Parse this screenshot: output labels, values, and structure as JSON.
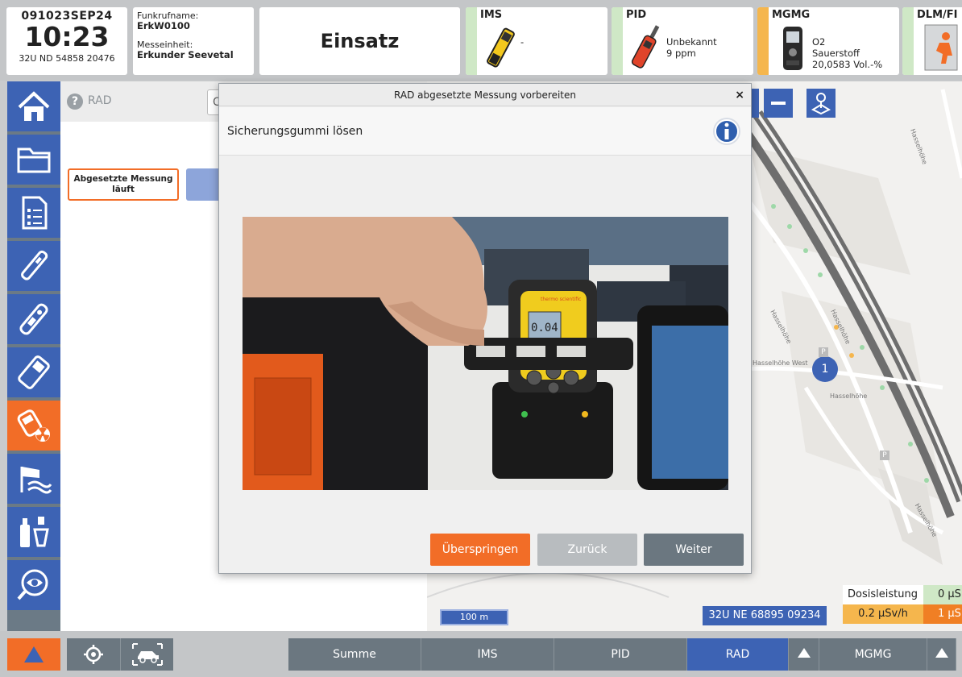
{
  "topbar": {
    "clock": {
      "date": "091023SEP24",
      "time": "10:23",
      "coord": "32U ND 54858 20476"
    },
    "radio": {
      "call_sign_label": "Funkrufname:",
      "call_sign": "ErkW0100",
      "unit_label": "Messeinheit:",
      "unit": "Erkunder Seevetal"
    },
    "mode": "Einsatz",
    "devices": [
      {
        "name": "IMS",
        "line1": "",
        "line2": "-"
      },
      {
        "name": "PID",
        "line1": "Unbekannt",
        "line2": "9 ppm"
      },
      {
        "name": "MGMG",
        "line1": "O2",
        "line2": "Sauerstoff",
        "line3": "20,0583 Vol.-%"
      },
      {
        "name": "DLM/FI"
      }
    ]
  },
  "sidenav": {
    "items": [
      {
        "icon": "home-icon"
      },
      {
        "icon": "folder-icon"
      },
      {
        "icon": "checklist-icon"
      },
      {
        "icon": "pid-probe-icon"
      },
      {
        "icon": "ims-probe-icon"
      },
      {
        "icon": "gas-meter-icon"
      },
      {
        "icon": "radiation-meter-icon",
        "active": true
      },
      {
        "icon": "weather-icon"
      },
      {
        "icon": "sampling-icon"
      },
      {
        "icon": "observation-icon"
      }
    ]
  },
  "leftpanel": {
    "title": "RAD",
    "header_button": "C",
    "measurement_button": "Abgesetzte Messung läuft"
  },
  "map": {
    "scale": "100 m",
    "coordinate": "32U NE 68895 09234",
    "marker": "1",
    "street_labels": [
      "Hasselhöhe",
      "Hasselhöhe",
      "Hasselhöhe",
      "Hasselhöhe West",
      "Hasselhöhe"
    ],
    "dose": {
      "label": "Dosisleistung",
      "label_value": "0 µS",
      "value1": "0.2 µSv/h",
      "value2": "1 µS"
    }
  },
  "dialog": {
    "title": "RAD abgesetzte Messung vorbereiten",
    "close": "×",
    "step": "Sicherungsgummi lösen",
    "screen_value": "0.04",
    "brand": "thermo scientific",
    "buttons": {
      "skip": "Überspringen",
      "back": "Zurück",
      "next": "Weiter"
    }
  },
  "bottombar": {
    "tabs": [
      "Summe",
      "IMS",
      "PID",
      "RAD",
      "MGMG"
    ],
    "active_tab": "RAD"
  },
  "colors": {
    "nav_blue": "#3d63b4",
    "accent_orange": "#f26d27",
    "ok_green": "#cfe8c6",
    "warn_yellow": "#f5b64d",
    "button_grey": "#6b7780"
  }
}
